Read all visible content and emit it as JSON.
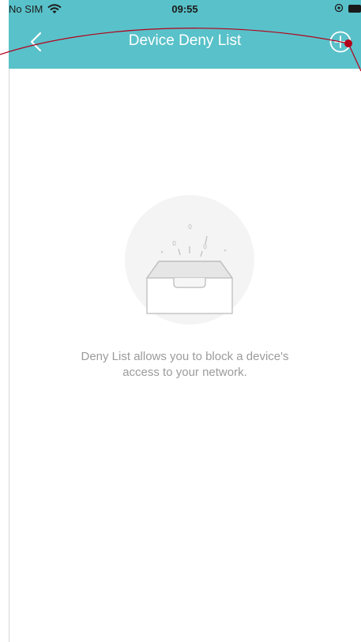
{
  "status_bar": {
    "carrier": "No SIM",
    "time": "09:55"
  },
  "nav": {
    "title": "Device Deny List"
  },
  "empty_state": {
    "line1": "Deny List allows you to block a device's",
    "line2": "access to your network."
  },
  "colors": {
    "header_bg": "#59c1c9",
    "annotation": "#b3001b",
    "empty_text": "#9b9b9b"
  },
  "icons": {
    "back": "chevron-left-icon",
    "add": "plus-circle-icon",
    "wifi": "wifi-icon",
    "battery": "battery-icon",
    "empty": "empty-tray-icon"
  }
}
